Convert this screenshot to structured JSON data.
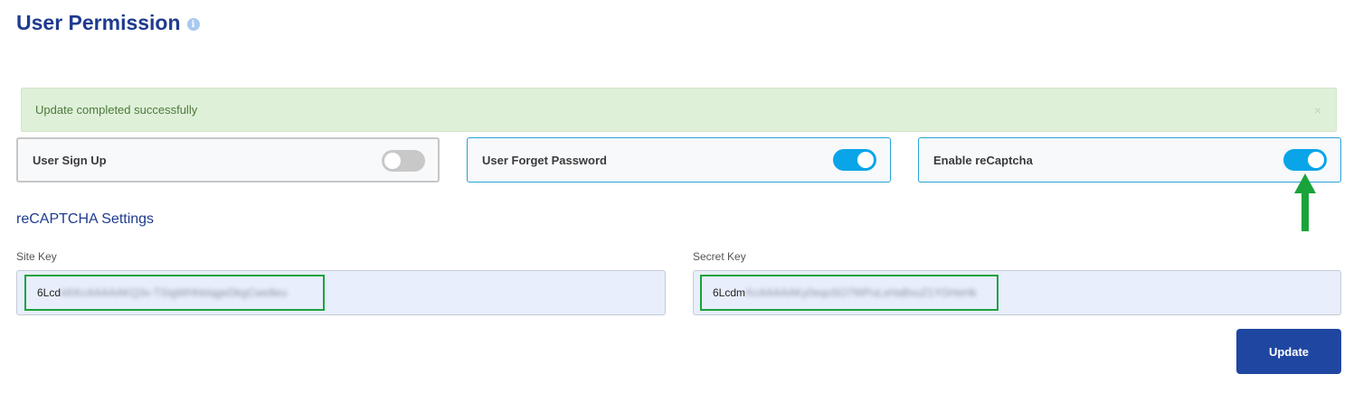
{
  "header": {
    "title": "User Permission",
    "info_icon": "info-icon"
  },
  "alert": {
    "message": "Update completed successfully",
    "close_symbol": "×",
    "type": "success"
  },
  "toggles": [
    {
      "label": "User Sign Up",
      "enabled": false
    },
    {
      "label": "User Forget Password",
      "enabled": true
    },
    {
      "label": "Enable reCaptcha",
      "enabled": true
    }
  ],
  "recaptcha": {
    "section_title": "reCAPTCHA Settings",
    "site_key": {
      "label": "Site Key",
      "visible_prefix": "6Lcd",
      "obscured_text": "kKKcAAAAAKQ3v-TSIgWHhbIqgeDkgCwe8eu"
    },
    "secret_key": {
      "label": "Secret Key",
      "visible_prefix": "6Lcdm",
      "obscured_text": "KcAAAAAKy0eqoSO7WPuLxHaBxuZ1YGHeHk"
    }
  },
  "actions": {
    "update_label": "Update"
  },
  "colors": {
    "brand_blue": "#1f3b8f",
    "toggle_on": "#0aa5e8",
    "highlight_green": "#1aa33b",
    "button_bg": "#1f47a1"
  }
}
